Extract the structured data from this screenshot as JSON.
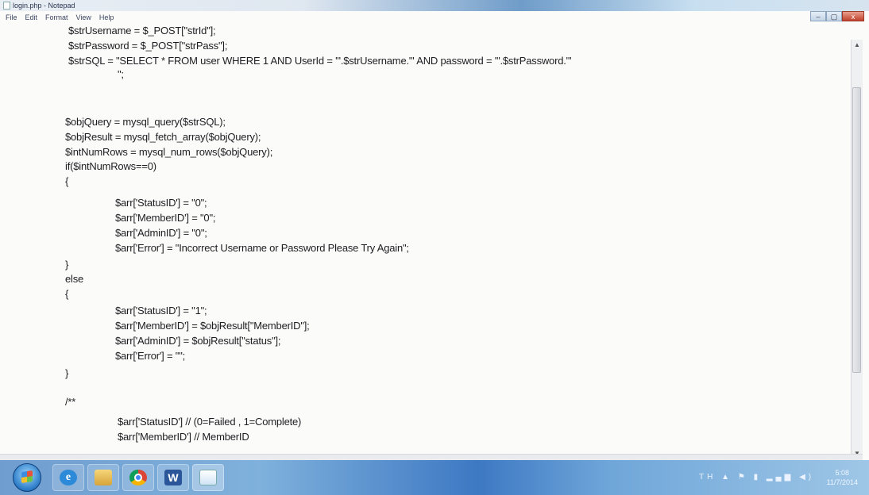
{
  "window": {
    "title": "login.php - Notepad",
    "controls": {
      "minimize": "–",
      "maximize": "▢",
      "close": "x"
    }
  },
  "menu": [
    "File",
    "Edit",
    "Format",
    "View",
    "Help"
  ],
  "code_lines": [
    "$strUsername = $_POST[\"strId\"];",
    "$strPassword = $_POST[\"strPass\"];",
    "$strSQL = \"SELECT * FROM user WHERE 1 AND UserId = '\".$strUsername.\"' AND password = '\".$strPassword.\"'",
    "\";",
    "$objQuery = mysql_query($strSQL);",
    "$objResult = mysql_fetch_array($objQuery);",
    "$intNumRows = mysql_num_rows($objQuery);",
    "if($intNumRows==0)",
    "{",
    "$arr['StatusID'] = \"0\";",
    "$arr['MemberID'] = \"0\";",
    "$arr['AdminID'] = \"0\";",
    "$arr['Error'] = \"Incorrect Username or Password Please Try Again\";",
    "}",
    "else",
    "{",
    "$arr['StatusID'] = \"1\";",
    "$arr['MemberID'] = $objResult[\"MemberID\"];",
    "$arr['AdminID'] = $objResult[\"status\"];",
    "$arr['Error'] = \"\";",
    "}",
    "/**",
    "$arr['StatusID'] // (0=Failed , 1=Complete)",
    "$arr['MemberID'] // MemberID"
  ],
  "taskbar": {
    "apps": [
      "start-button",
      "ie-icon",
      "explorer-icon",
      "chrome-icon",
      "word-icon",
      "notepad-icon"
    ],
    "tray": {
      "lang": "TH",
      "time": "5:08",
      "date": "11/7/2014"
    }
  },
  "colors": {
    "accent": "#3d78c3",
    "text": "#1e1e22",
    "editor_bg": "#fbfbfa"
  }
}
